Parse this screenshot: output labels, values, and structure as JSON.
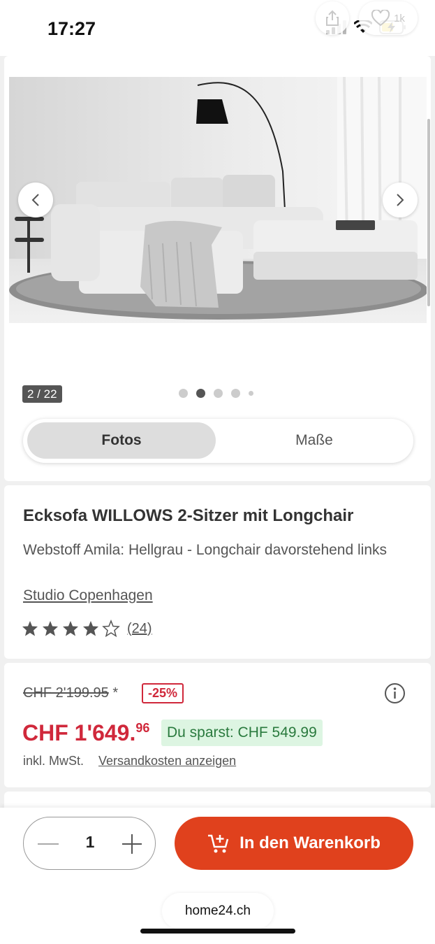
{
  "status_bar": {
    "time": "17:27",
    "like_count": "1k",
    "icons": [
      "signal-icon",
      "wifi-icon",
      "battery-charging-icon"
    ]
  },
  "gallery": {
    "counter": "2 / 22",
    "dots_total": 5,
    "dot_active_index": 1,
    "tabs": [
      {
        "label": "Fotos",
        "active": true
      },
      {
        "label": "Maße",
        "active": false
      }
    ]
  },
  "product": {
    "title": "Ecksofa WILLOWS 2-Sitzer mit Longchair",
    "variant": "Webstoff Amila: Hellgrau - Longchair davorstehend links",
    "brand": "Studio Copenhagen",
    "rating_value": 4.5,
    "rating_max": 5,
    "rating_count": "(24)"
  },
  "price": {
    "old_price": "CHF 2'199.95",
    "old_price_marker": "*",
    "discount": "-25%",
    "new_price_main": "CHF 1'649.",
    "new_price_cents": "96",
    "savings": "Du sparst: CHF 549.99",
    "tax_note": "inkl. MwSt.",
    "shipping_link": "Versandkosten anzeigen"
  },
  "buy_bar": {
    "quantity": "1",
    "cart_button_label": "In den Warenkorb"
  },
  "browser": {
    "url": "home24.ch"
  },
  "colors": {
    "accent": "#e0411d",
    "price_red": "#d0283b",
    "savings_bg": "#ddf5e2",
    "savings_text": "#2a7a3e"
  }
}
